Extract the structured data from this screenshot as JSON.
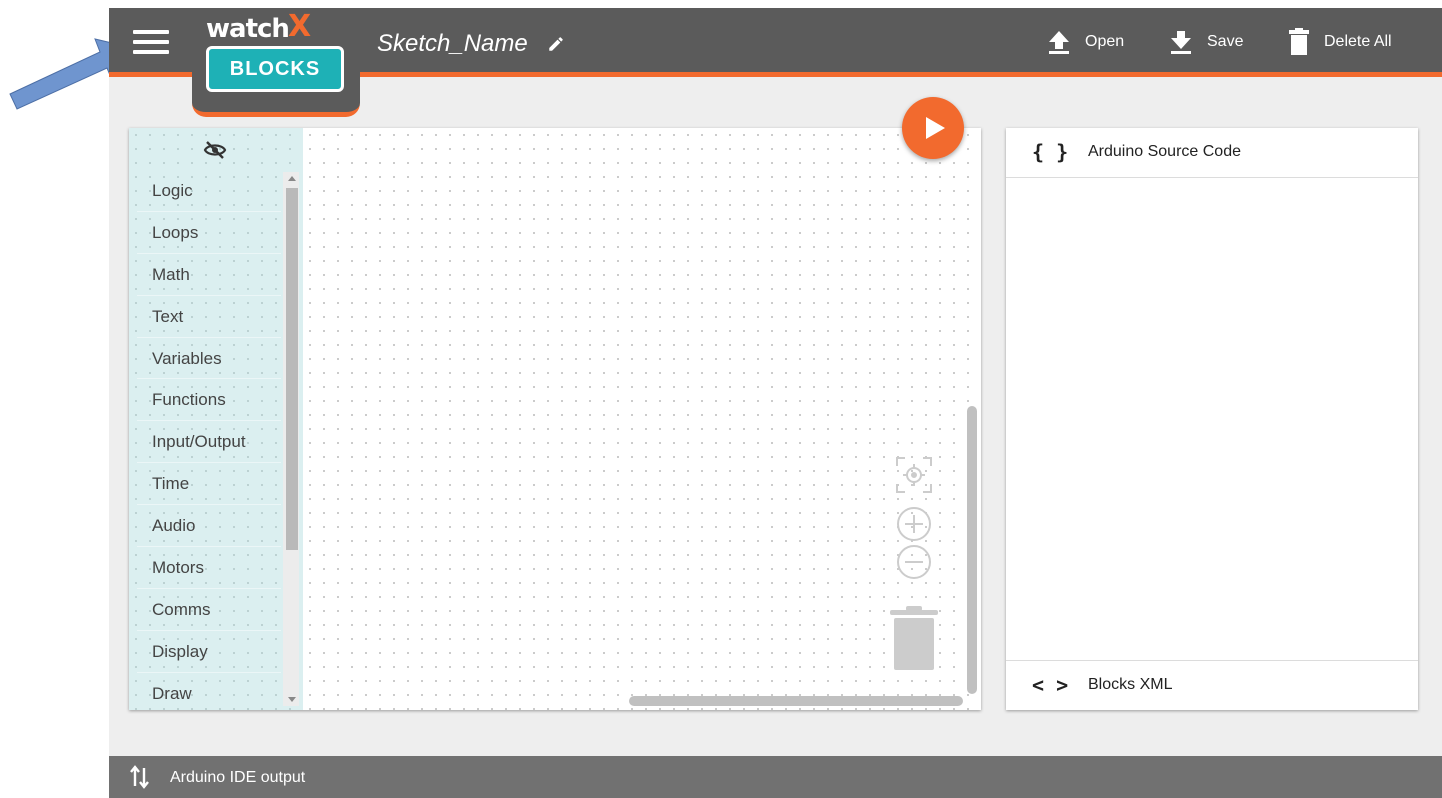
{
  "header": {
    "logo_top": "watch",
    "logo_x": "X",
    "logo_bottom": "BLOCKS",
    "sketch_name": "Sketch_Name",
    "open_label": "Open",
    "save_label": "Save",
    "delete_all_label": "Delete All"
  },
  "toolbox": {
    "items": [
      "Logic",
      "Loops",
      "Math",
      "Text",
      "Variables",
      "Functions",
      "Input/Output",
      "Time",
      "Audio",
      "Motors",
      "Comms",
      "Display",
      "Draw"
    ]
  },
  "code_panel": {
    "source_icon": "{ }",
    "source_label": "Arduino Source Code",
    "xml_icon": "< >",
    "xml_label": "Blocks XML"
  },
  "footer": {
    "output_label": "Arduino IDE output"
  },
  "icons": {
    "menu": "hamburger-menu-icon",
    "edit": "pencil-icon",
    "open": "upload-icon",
    "save": "download-icon",
    "delete": "trash-icon",
    "toolbox_toggle": "eye-off-icon",
    "run": "play-icon",
    "recenter": "recenter-icon",
    "zoom_in": "zoom-in-icon",
    "zoom_out": "zoom-out-icon",
    "workspace_trash": "trash-icon",
    "output": "swap-vertical-icon"
  },
  "colors": {
    "header": "#5b5b5b",
    "accent": "#f26a2e",
    "logo_teal": "#1eb1b6",
    "toolbox_bg": "#dbeff0",
    "output_bar": "#717171",
    "annotation_arrow": "#6f95cf"
  }
}
